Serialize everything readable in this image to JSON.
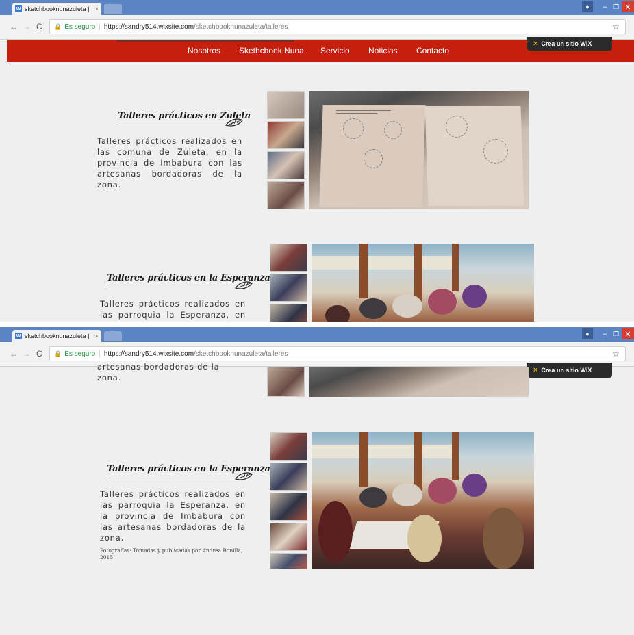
{
  "browser": {
    "tab_title": "sketchbooknunazuleta |",
    "tab_close": "×",
    "secure_label": "Es seguro",
    "url_host": "https://sandry514.wixsite.com",
    "url_path": "/sketchbooknunazuleta/talleres",
    "favicon": "wix-icon",
    "lock_icon": "🔒",
    "star_icon": "☆"
  },
  "menu": {
    "items": [
      "Nosotros",
      "Skethcbook Nuna",
      "Servicio",
      "Noticias",
      "Contacto"
    ]
  },
  "wix_banner": {
    "label": "Crea un sitio WiX"
  },
  "sections": [
    {
      "title": "Talleres prácticos en Zuleta",
      "description": "Talleres prácticos realizados en las comuna de Zuleta, en la provincia de Imbabura con las artesanas bordadoras de la zona."
    },
    {
      "title": "Talleres prácticos en la Esperanza",
      "description": "Talleres prácticos realizados en las parroquia la Esperanza, en la provincia de Imbabura con las artesanas bordadoras de la zona.",
      "credit": "Fotografías: Tomadas y publicadas por Andrea Bonilla, 2015"
    }
  ],
  "second_view": {
    "partial_description": "artesanas   bordadoras   de   la",
    "partial_description_end": "zona."
  },
  "colors": {
    "title_bar": "#5b84c4",
    "nav_bar": "#c5200e",
    "page_bg": "#efefef",
    "wix_badge": "#2b2b2b"
  }
}
